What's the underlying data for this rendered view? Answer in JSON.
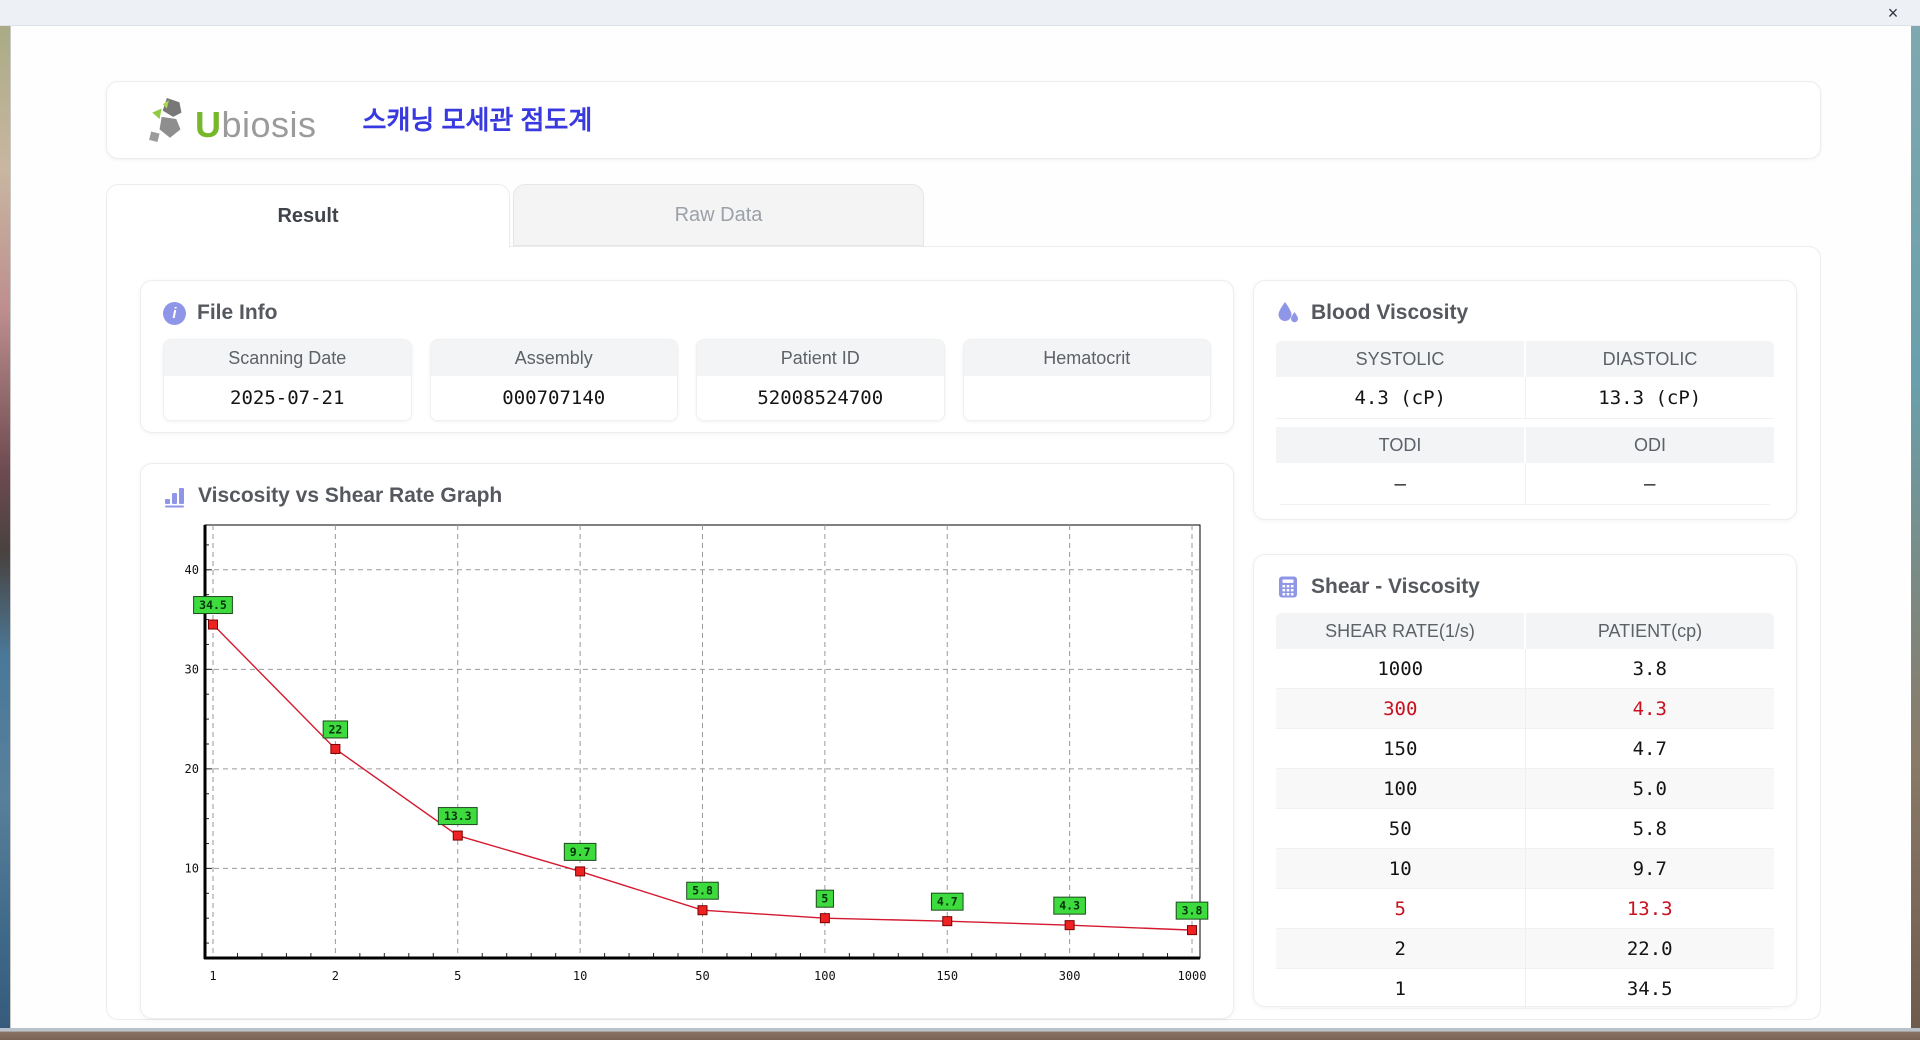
{
  "window": {
    "close_label": "×"
  },
  "header": {
    "logo_u": "U",
    "logo_rest": "biosis",
    "app_title": "스캐닝 모세관 점도계"
  },
  "tabs": [
    {
      "label": "Result",
      "active": true
    },
    {
      "label": "Raw Data",
      "active": false
    }
  ],
  "file_info": {
    "title": "File Info",
    "fields": [
      {
        "label": "Scanning Date",
        "value": "2025-07-21"
      },
      {
        "label": "Assembly",
        "value": "000707140"
      },
      {
        "label": "Patient ID",
        "value": "52008524700"
      },
      {
        "label": "Hematocrit",
        "value": ""
      }
    ]
  },
  "blood_viscosity": {
    "title": "Blood Viscosity",
    "systolic_label": "SYSTOLIC",
    "diastolic_label": "DIASTOLIC",
    "systolic_value": "4.3 (cP)",
    "diastolic_value": "13.3 (cP)",
    "todi_label": "TODI",
    "odi_label": "ODI",
    "todi_value": "–",
    "odi_value": "–"
  },
  "graph_section": {
    "title": "Viscosity vs Shear Rate Graph"
  },
  "shear_table": {
    "title": "Shear - Viscosity",
    "headers": [
      "SHEAR RATE(1/s)",
      "PATIENT(cp)"
    ],
    "rows": [
      {
        "shear": "1000",
        "patient": "3.8",
        "highlight": false
      },
      {
        "shear": "300",
        "patient": "4.3",
        "highlight": true
      },
      {
        "shear": "150",
        "patient": "4.7",
        "highlight": false
      },
      {
        "shear": "100",
        "patient": "5.0",
        "highlight": false
      },
      {
        "shear": "50",
        "patient": "5.8",
        "highlight": false
      },
      {
        "shear": "10",
        "patient": "9.7",
        "highlight": false
      },
      {
        "shear": "5",
        "patient": "13.3",
        "highlight": true
      },
      {
        "shear": "2",
        "patient": "22.0",
        "highlight": false
      },
      {
        "shear": "1",
        "patient": "34.5",
        "highlight": false
      }
    ]
  },
  "chart_data": {
    "type": "line",
    "title": "Viscosity vs Shear Rate Graph",
    "x_axis_type": "category",
    "x_categories": [
      "1",
      "2",
      "5",
      "10",
      "50",
      "100",
      "150",
      "300",
      "1000"
    ],
    "values": [
      34.5,
      22,
      13.3,
      9.7,
      5.8,
      5,
      4.7,
      4.3,
      3.8
    ],
    "point_labels": [
      "34.5",
      "22",
      "13.3",
      "9.7",
      "5.8",
      "5",
      "4.7",
      "4.3",
      "3.8"
    ],
    "y_ticks": [
      10,
      20,
      30,
      40
    ],
    "ylim": [
      1.0,
      44.5
    ],
    "grid": "dashed",
    "legend": "none",
    "line_color": "#d41a30",
    "marker_color": "#ee2222",
    "marker_edge": "#7a0000",
    "label_bg": "#3ddb3d",
    "label_border": "#1d4a1d",
    "label_text_color": "#05320a"
  },
  "colors": {
    "accent_purple": "#8f96e8",
    "highlight_red": "#c9101f",
    "title_blue": "#3939e0",
    "logo_green": "#76b82a"
  }
}
